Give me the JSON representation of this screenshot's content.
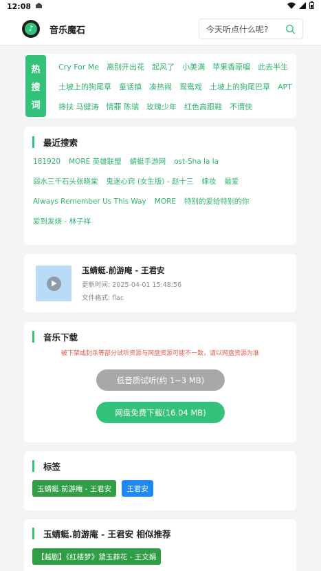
{
  "status_bar": {
    "time": "12:08"
  },
  "app": {
    "title": "音乐魔石",
    "logo_glyph": "♪"
  },
  "search": {
    "placeholder": "今天听点什么呢?"
  },
  "hot_search": {
    "badge": [
      "热",
      "搜",
      "词"
    ],
    "tags": [
      "Cry For Me",
      "离别开出花",
      "起风了",
      "小美满",
      "苹果香原唱",
      "此去半生",
      "土坡上的狗尾草",
      "童话镇",
      "凑热闹",
      "鸳鸯戏",
      "土坡上的狗尾巴草",
      "APT",
      "搀扶 马健涛",
      "情罪 陈瑞",
      "玫瑰少年",
      "红色高跟鞋",
      "不谓侠"
    ]
  },
  "recent": {
    "title": "最近搜索",
    "items": [
      "181920",
      "MORE 英雄联盟",
      "蜻蜓手游网",
      "ost-Sha la la",
      "弱水三千石头张晓棠",
      "鬼迷心窍 (女生版) - 赵十三",
      "嫁妆",
      "最爱",
      "Always Remember Us This Way",
      "MORE",
      "特别的爱给特别的你",
      "爱到发烧 - 林子祥"
    ]
  },
  "song": {
    "title": "玉蜻蜓.前游庵 - 王君安",
    "update_label": "更新时间:",
    "update_value": "2025-04-01 15:48:56",
    "format_label": "文件格式:",
    "format_value": "flac"
  },
  "download": {
    "title": "音乐下载",
    "notice": "被下架或封杀等部分试听资源与网盘资源可能不一致，请以网盘资源为准",
    "low_quality_button": "低音质试听(约 1~3 MB)",
    "free_download_button": "网盘免费下载(16.04 MB)"
  },
  "tags": {
    "title": "标签",
    "items": [
      {
        "label": "玉蜻蜓.前游庵 - 王君安",
        "color": "#2f9e44"
      },
      {
        "label": "王君安",
        "color": "#1e88f5"
      }
    ]
  },
  "similar": {
    "title": "玉蜻蜓.前游庵 - 王君安 相似推荐",
    "items": [
      "【越剧】《红楼梦》黛玉葬花 - 王文娟"
    ]
  },
  "colors": {
    "accent": "#33c27a",
    "notice": "#e9574b",
    "blue_tag": "#1e88f5"
  }
}
